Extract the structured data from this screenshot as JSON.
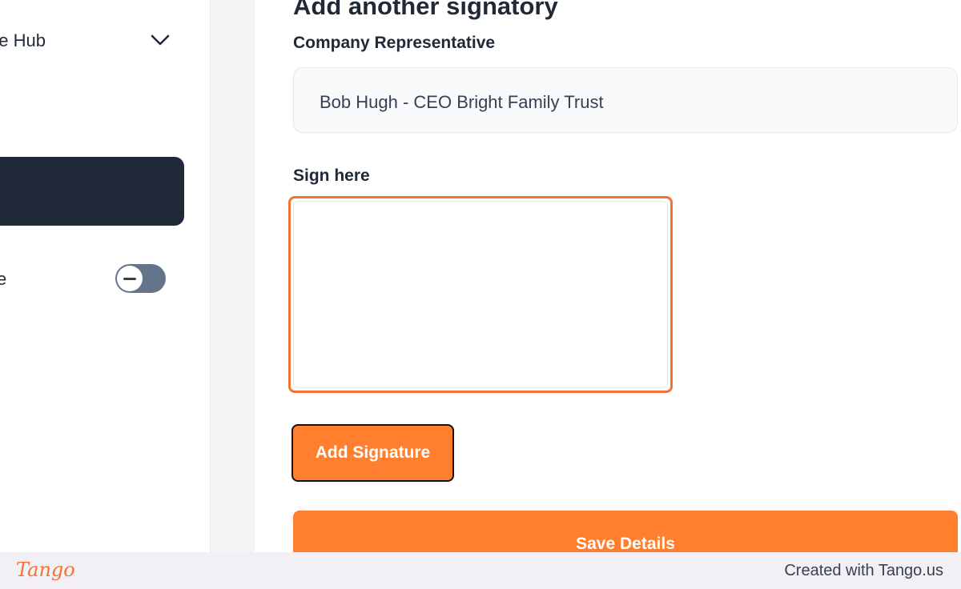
{
  "sidebar": {
    "hub_label": "ge Hub",
    "toggle_label": "e",
    "toggle_on": false
  },
  "form": {
    "heading": "Add another signatory",
    "rep_label": "Company Representative",
    "rep_value": "Bob Hugh - CEO Bright Family Trust",
    "sign_label": "Sign here",
    "add_signature": "Add Signature",
    "save_details": "Save Details"
  },
  "footer": {
    "logo": "Tango",
    "credit": "Created with Tango.us"
  },
  "colors": {
    "accent": "#ff7f2e",
    "highlight": "#f37335",
    "dark": "#1f2937"
  }
}
